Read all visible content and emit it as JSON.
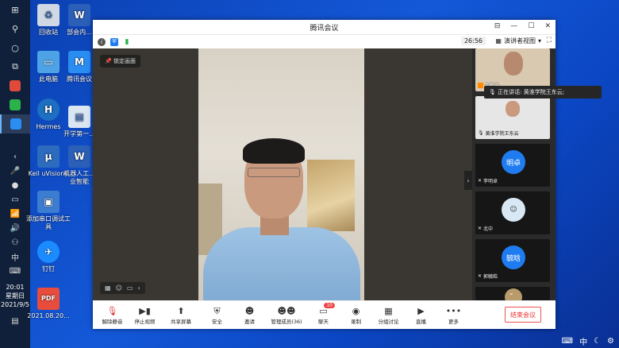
{
  "taskbar": {
    "clock_time": "20:01",
    "clock_day": "星期日",
    "clock_date": "2021/9/5",
    "ime": "中"
  },
  "desktop_icons": [
    {
      "label": "回收站",
      "color": "#cfd8e3",
      "glyph": "♻"
    },
    {
      "label": "此电脑",
      "color": "#4da3e6",
      "glyph": "▭"
    },
    {
      "label": "Hermes",
      "color": "#1d6fc1",
      "glyph": "H"
    },
    {
      "label": "Keil uVision4",
      "color": "#2c6bbd",
      "glyph": "μ"
    },
    {
      "label": "添加串口调试工具",
      "color": "#3c7dd1",
      "glyph": "▣"
    },
    {
      "label": "钉钉",
      "color": "#1a8cff",
      "glyph": "✈"
    },
    {
      "label": "2021.08.20...",
      "color": "#e74c3c",
      "glyph": "PDF"
    },
    {
      "label": "部会内...",
      "color": "#2b5fb8",
      "glyph": "W"
    },
    {
      "label": "腾讯会议",
      "color": "#2a8df2",
      "glyph": "M"
    },
    {
      "label": "开学第一...",
      "color": "#dbe6f3",
      "glyph": "▤"
    },
    {
      "label": "机器人工...业智能",
      "color": "#2b5fb8",
      "glyph": "W"
    }
  ],
  "window": {
    "title": "腾讯会议",
    "timer": "26:56",
    "view_label": "演讲者视图",
    "lock_label": "锁定画面",
    "speaking_label": "正在讲话: 黄淮学院王东云;"
  },
  "participants": [
    {
      "name": "刘新玉",
      "type": "video",
      "color": "#d8c9b0"
    },
    {
      "name": "黄淮学院王东云",
      "type": "video",
      "color": "#e6e6e6"
    },
    {
      "name": "李明卓",
      "type": "avatar",
      "avatar_text": "明卓",
      "color": "#1f7cf0"
    },
    {
      "name": "北中",
      "type": "avatar",
      "avatar_text": "",
      "color": "#d9e8f5"
    },
    {
      "name": "郭毓皓",
      "type": "avatar",
      "avatar_text": "毓晗",
      "color": "#1f7cf0"
    },
    {
      "name": "",
      "type": "avatar",
      "avatar_text": "",
      "color": "#b99a6a"
    }
  ],
  "toolbar": [
    {
      "label": "解除静音",
      "icon": "mic-muted-icon",
      "glyph": "🎙"
    },
    {
      "label": "停止视频",
      "icon": "camera-icon",
      "glyph": "📹"
    },
    {
      "label": "共享屏幕",
      "icon": "share-screen-icon",
      "glyph": "⬆"
    },
    {
      "label": "安全",
      "icon": "shield-icon",
      "glyph": "⛨"
    },
    {
      "label": "邀请",
      "icon": "invite-icon",
      "glyph": "👤"
    },
    {
      "label": "管理成员(36)",
      "icon": "members-icon",
      "glyph": "👥"
    },
    {
      "label": "聊天",
      "icon": "chat-icon",
      "glyph": "💬",
      "badge": "10"
    },
    {
      "label": "录制",
      "icon": "record-icon",
      "glyph": "◉"
    },
    {
      "label": "分组讨论",
      "icon": "breakout-icon",
      "glyph": "▦"
    },
    {
      "label": "直播",
      "icon": "live-icon",
      "glyph": "▶"
    },
    {
      "label": "更多",
      "icon": "more-icon",
      "glyph": "•••"
    }
  ],
  "end_label": "结束会议"
}
